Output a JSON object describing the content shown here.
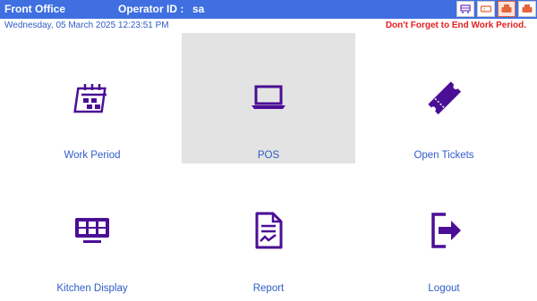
{
  "header": {
    "title": "Front Office",
    "operator_label": "Operator ID :",
    "operator_value": "sa",
    "buttons": [
      {
        "icon": "cart-icon"
      },
      {
        "icon": "ticket-icon"
      },
      {
        "icon": "printer-icon"
      },
      {
        "icon": "printer-icon"
      }
    ]
  },
  "status": {
    "datetime": "Wednesday, 05 March 2025 12:23:51 PM",
    "warning": "Don't Forget to End Work Period."
  },
  "tiles": [
    {
      "label": "Work Period",
      "icon": "calendar-icon",
      "selected": false
    },
    {
      "label": "POS",
      "icon": "laptop-icon",
      "selected": true
    },
    {
      "label": "Open Tickets",
      "icon": "ticket-icon",
      "selected": false
    },
    {
      "label": "Kitchen Display",
      "icon": "monitor-grid-icon",
      "selected": false
    },
    {
      "label": "Report",
      "icon": "report-document-icon",
      "selected": false
    },
    {
      "label": "Logout",
      "icon": "logout-icon",
      "selected": false
    }
  ],
  "colors": {
    "accent": "#3f6fe0",
    "icon": "#4b0e96",
    "label": "#2f5cc8",
    "warning": "#e52020",
    "selected_tile": "#e3e3e3"
  }
}
